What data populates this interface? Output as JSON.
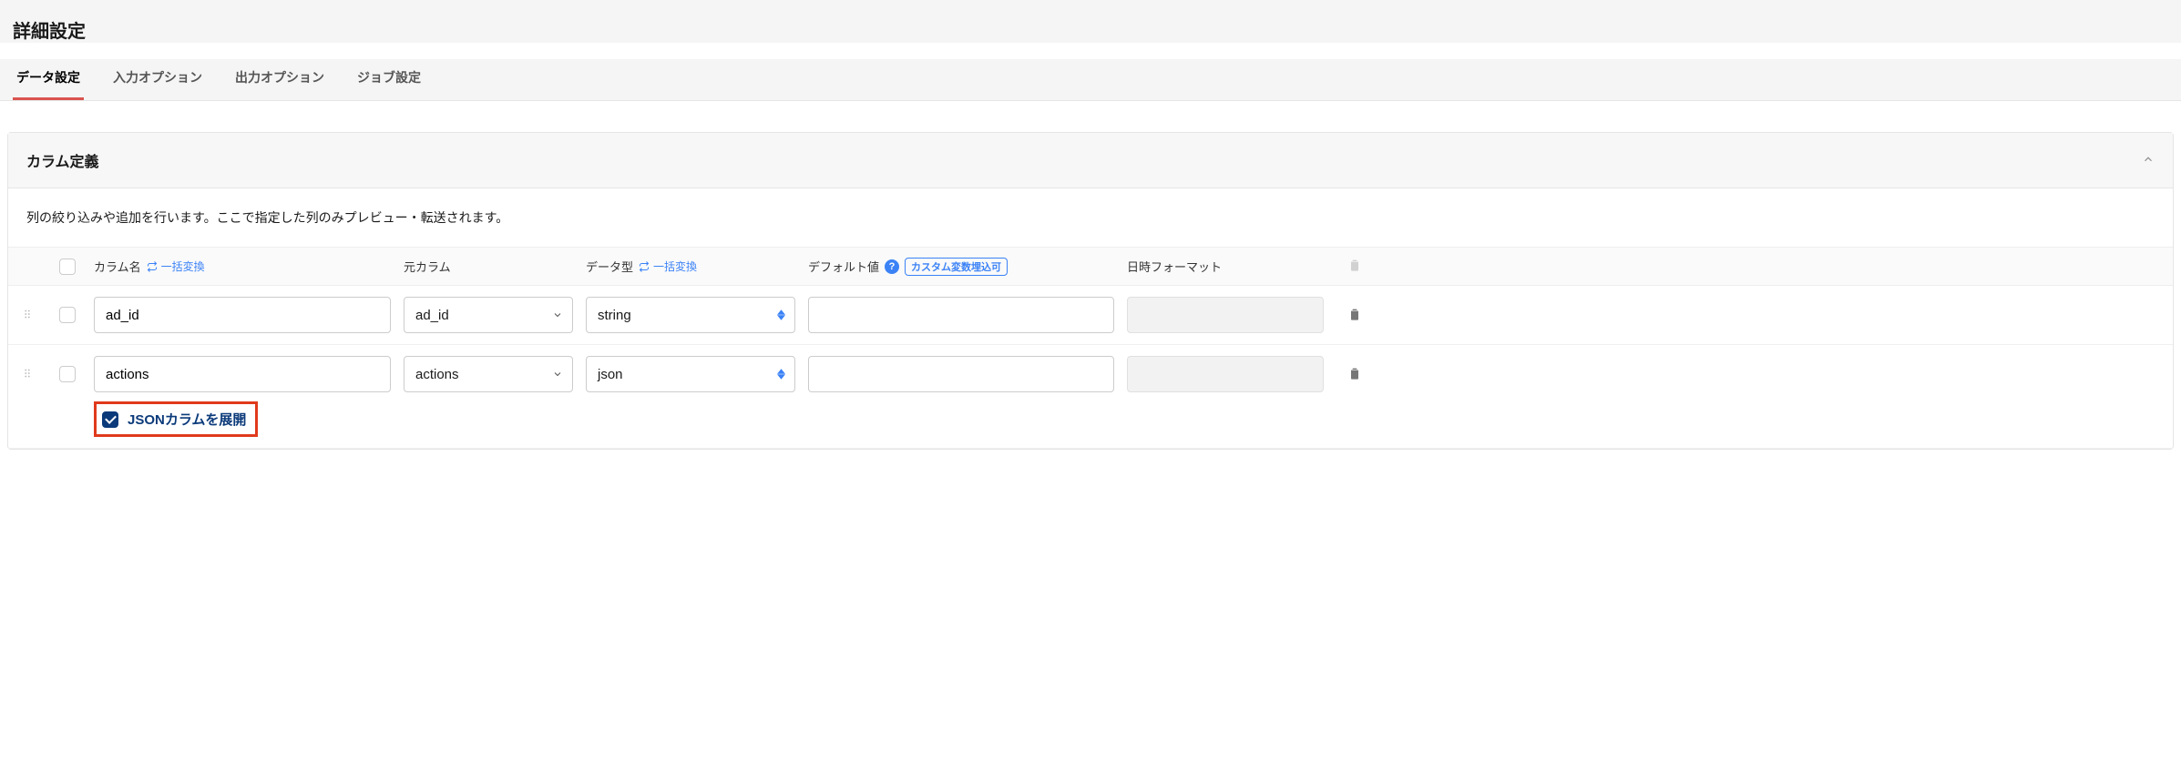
{
  "header": {
    "title": "詳細設定"
  },
  "tabs": [
    {
      "label": "データ設定",
      "active": true
    },
    {
      "label": "入力オプション",
      "active": false
    },
    {
      "label": "出力オプション",
      "active": false
    },
    {
      "label": "ジョブ設定",
      "active": false
    }
  ],
  "panel": {
    "title": "カラム定義",
    "description": "列の絞り込みや追加を行います。ここで指定した列のみプレビュー・転送されます。"
  },
  "columns_header": {
    "name": "カラム名",
    "batch1": "一括変換",
    "orig": "元カラム",
    "type": "データ型",
    "batch2": "一括変換",
    "default": "デフォルト値",
    "custom_var_tag": "カスタム変数埋込可",
    "datetime": "日時フォーマット"
  },
  "rows": [
    {
      "name": "ad_id",
      "orig": "ad_id",
      "type": "string",
      "default": "",
      "datetime_disabled": true,
      "delete_disabled": false,
      "json_expand": null
    },
    {
      "name": "actions",
      "orig": "actions",
      "type": "json",
      "default": "",
      "datetime_disabled": true,
      "delete_disabled": false,
      "json_expand": {
        "checked": true,
        "label": "JSONカラムを展開",
        "highlighted": true
      }
    }
  ]
}
